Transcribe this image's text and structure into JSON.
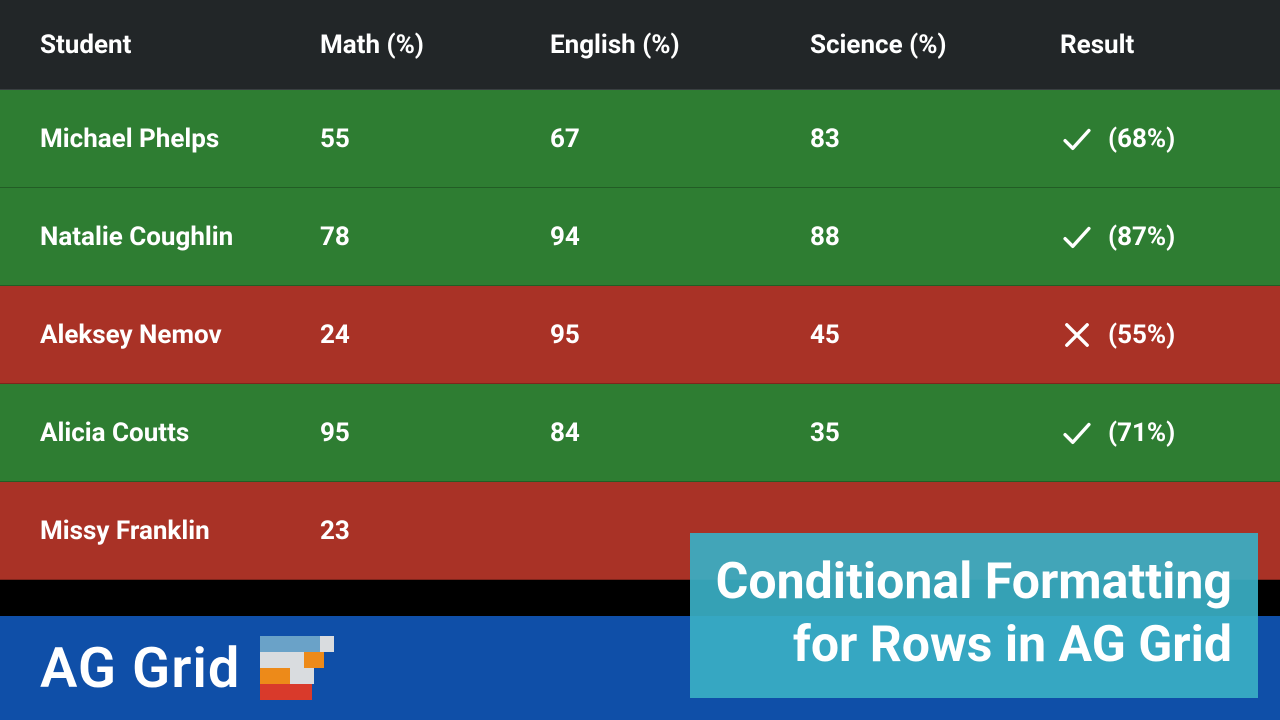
{
  "table": {
    "headers": {
      "student": "Student",
      "math": "Math (%)",
      "english": "English (%)",
      "science": "Science (%)",
      "result": "Result"
    },
    "rows": [
      {
        "student": "Michael Phelps",
        "math": "55",
        "english": "67",
        "science": "83",
        "status": "pass",
        "result_pct": "(68%)"
      },
      {
        "student": "Natalie Coughlin",
        "math": "78",
        "english": "94",
        "science": "88",
        "status": "pass",
        "result_pct": "(87%)"
      },
      {
        "student": "Aleksey Nemov",
        "math": "24",
        "english": "95",
        "science": "45",
        "status": "fail",
        "result_pct": "(55%)"
      },
      {
        "student": "Alicia Coutts",
        "math": "95",
        "english": "84",
        "science": "35",
        "status": "pass",
        "result_pct": "(71%)"
      },
      {
        "student": "Missy Franklin",
        "math": "23",
        "english": "",
        "science": "",
        "status": "fail",
        "result_pct": ""
      }
    ]
  },
  "brand": {
    "name": "AG Grid"
  },
  "title_card": {
    "line1": "Conditional Formatting",
    "line2": "for Rows in AG Grid"
  },
  "colors": {
    "pass": "#2e7d32",
    "fail": "#a93226",
    "footer": "#0f4fa8",
    "card": "#3aafc4"
  }
}
